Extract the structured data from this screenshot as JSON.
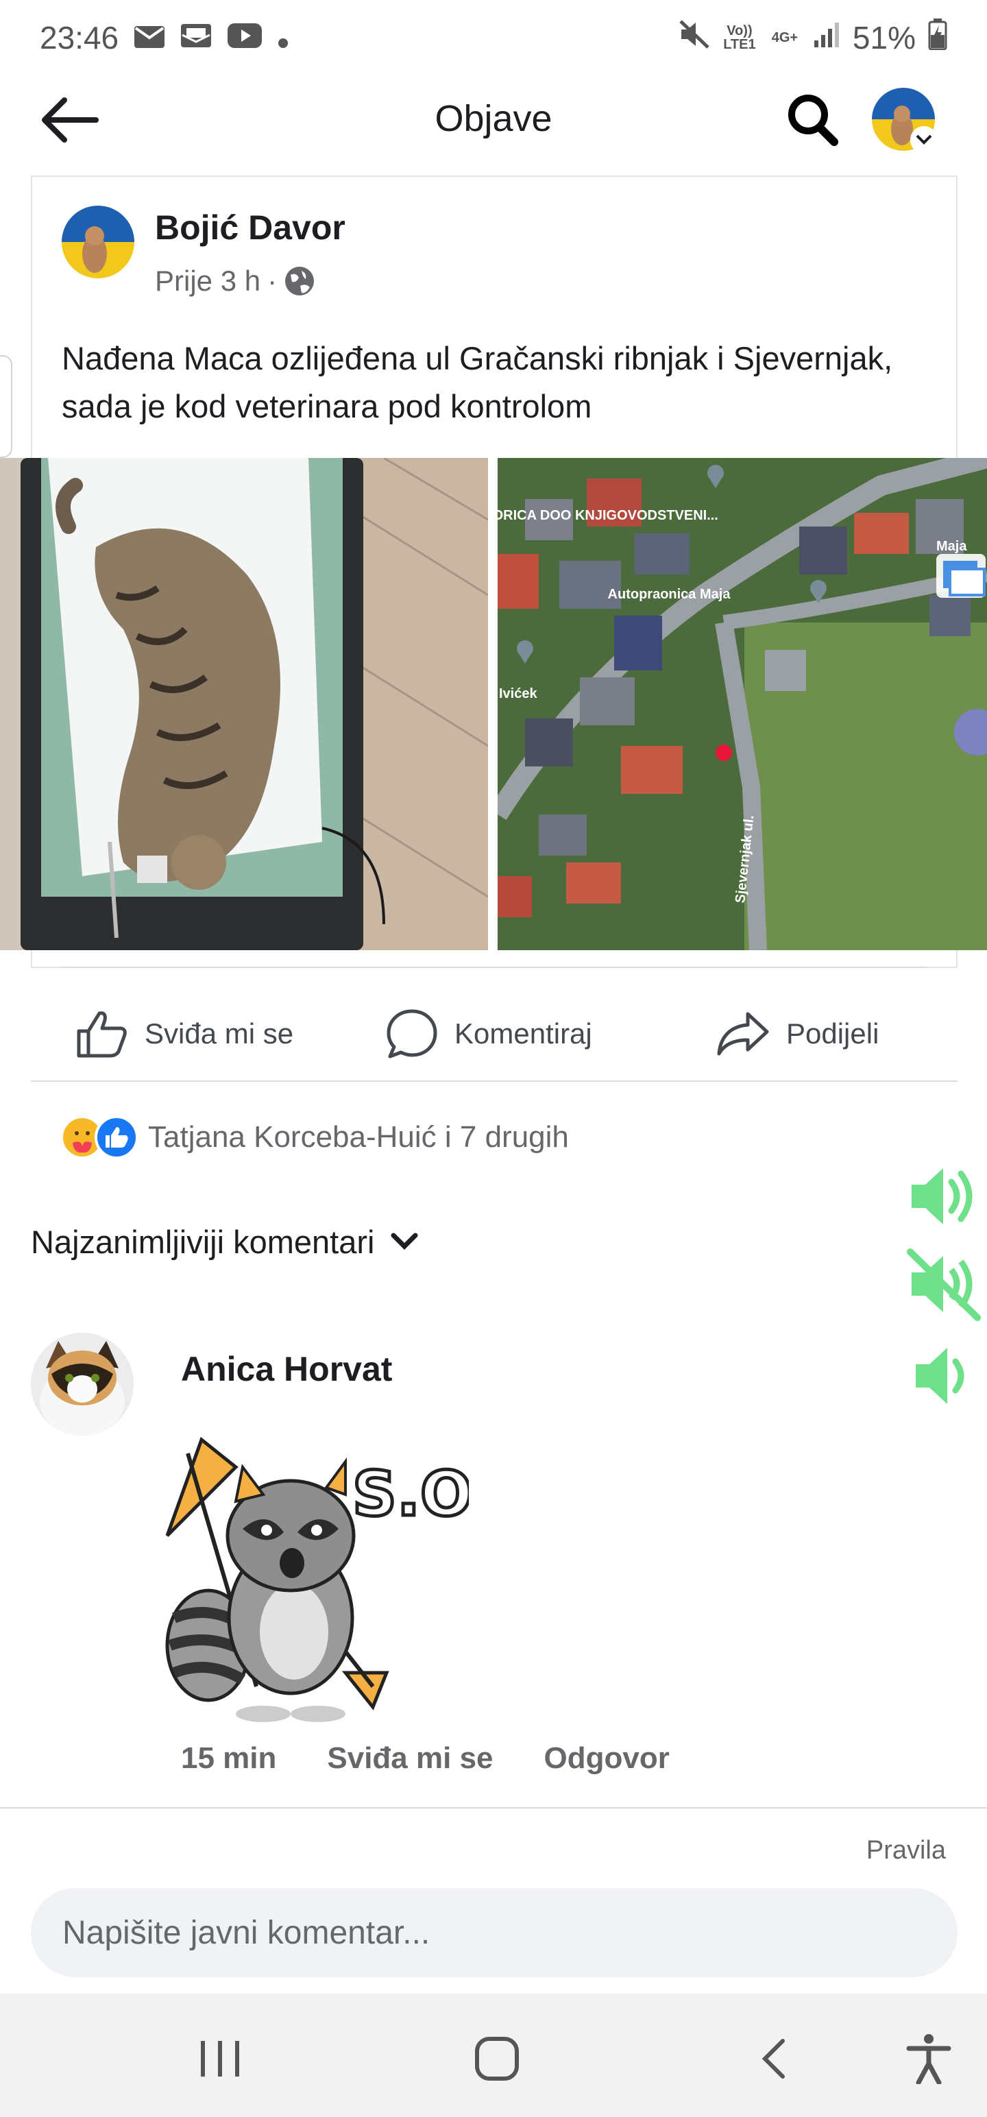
{
  "status_bar": {
    "time": "23:46",
    "network_top": "Vo)) LTE1",
    "network_right": "4G+",
    "battery": "51%",
    "icons": [
      "mail-icon",
      "mail-open-icon",
      "youtube-icon",
      "dot-icon",
      "mute-icon",
      "signal-icon",
      "battery-icon"
    ]
  },
  "header": {
    "title": "Objave",
    "back_icon": "arrow-left-icon",
    "search_icon": "search-icon"
  },
  "post": {
    "author": "Bojić Davor",
    "time": "Prije 3 h",
    "separator": "·",
    "privacy_icon": "globe-icon",
    "text": "Nađena Maca ozlijeđena ul Gračanski ribnjak i Sjevernjak, sada je kod veterinara pod kontrolom",
    "map_labels": {
      "business": "KORICA DOO KNJIGOVODSTVENI...",
      "car_wash": "Autopraonica Maja",
      "partial_left": "Ivićek",
      "partial_right": "Maja",
      "street": "Sjevernjak ul."
    }
  },
  "actions": {
    "like": "Sviđa mi se",
    "comment": "Komentiraj",
    "share": "Podijeli"
  },
  "reactions": {
    "text": "Tatjana Korceba-Huić i 7 drugih",
    "icons": [
      "care-icon",
      "like-icon"
    ]
  },
  "comments": {
    "sort_label": "Najzanimljiviji komentari",
    "items": [
      {
        "author": "Anica Horvat",
        "sticker_text": "S.O.S!",
        "time": "15 min",
        "like": "Sviđa mi se",
        "reply": "Odgovor"
      }
    ]
  },
  "composer": {
    "rules": "Pravila",
    "placeholder": "Napišite javni komentar..."
  },
  "colors": {
    "accent_blue": "#1877f2",
    "volume_green": "#6fe08a",
    "text_secondary": "#65676b"
  }
}
